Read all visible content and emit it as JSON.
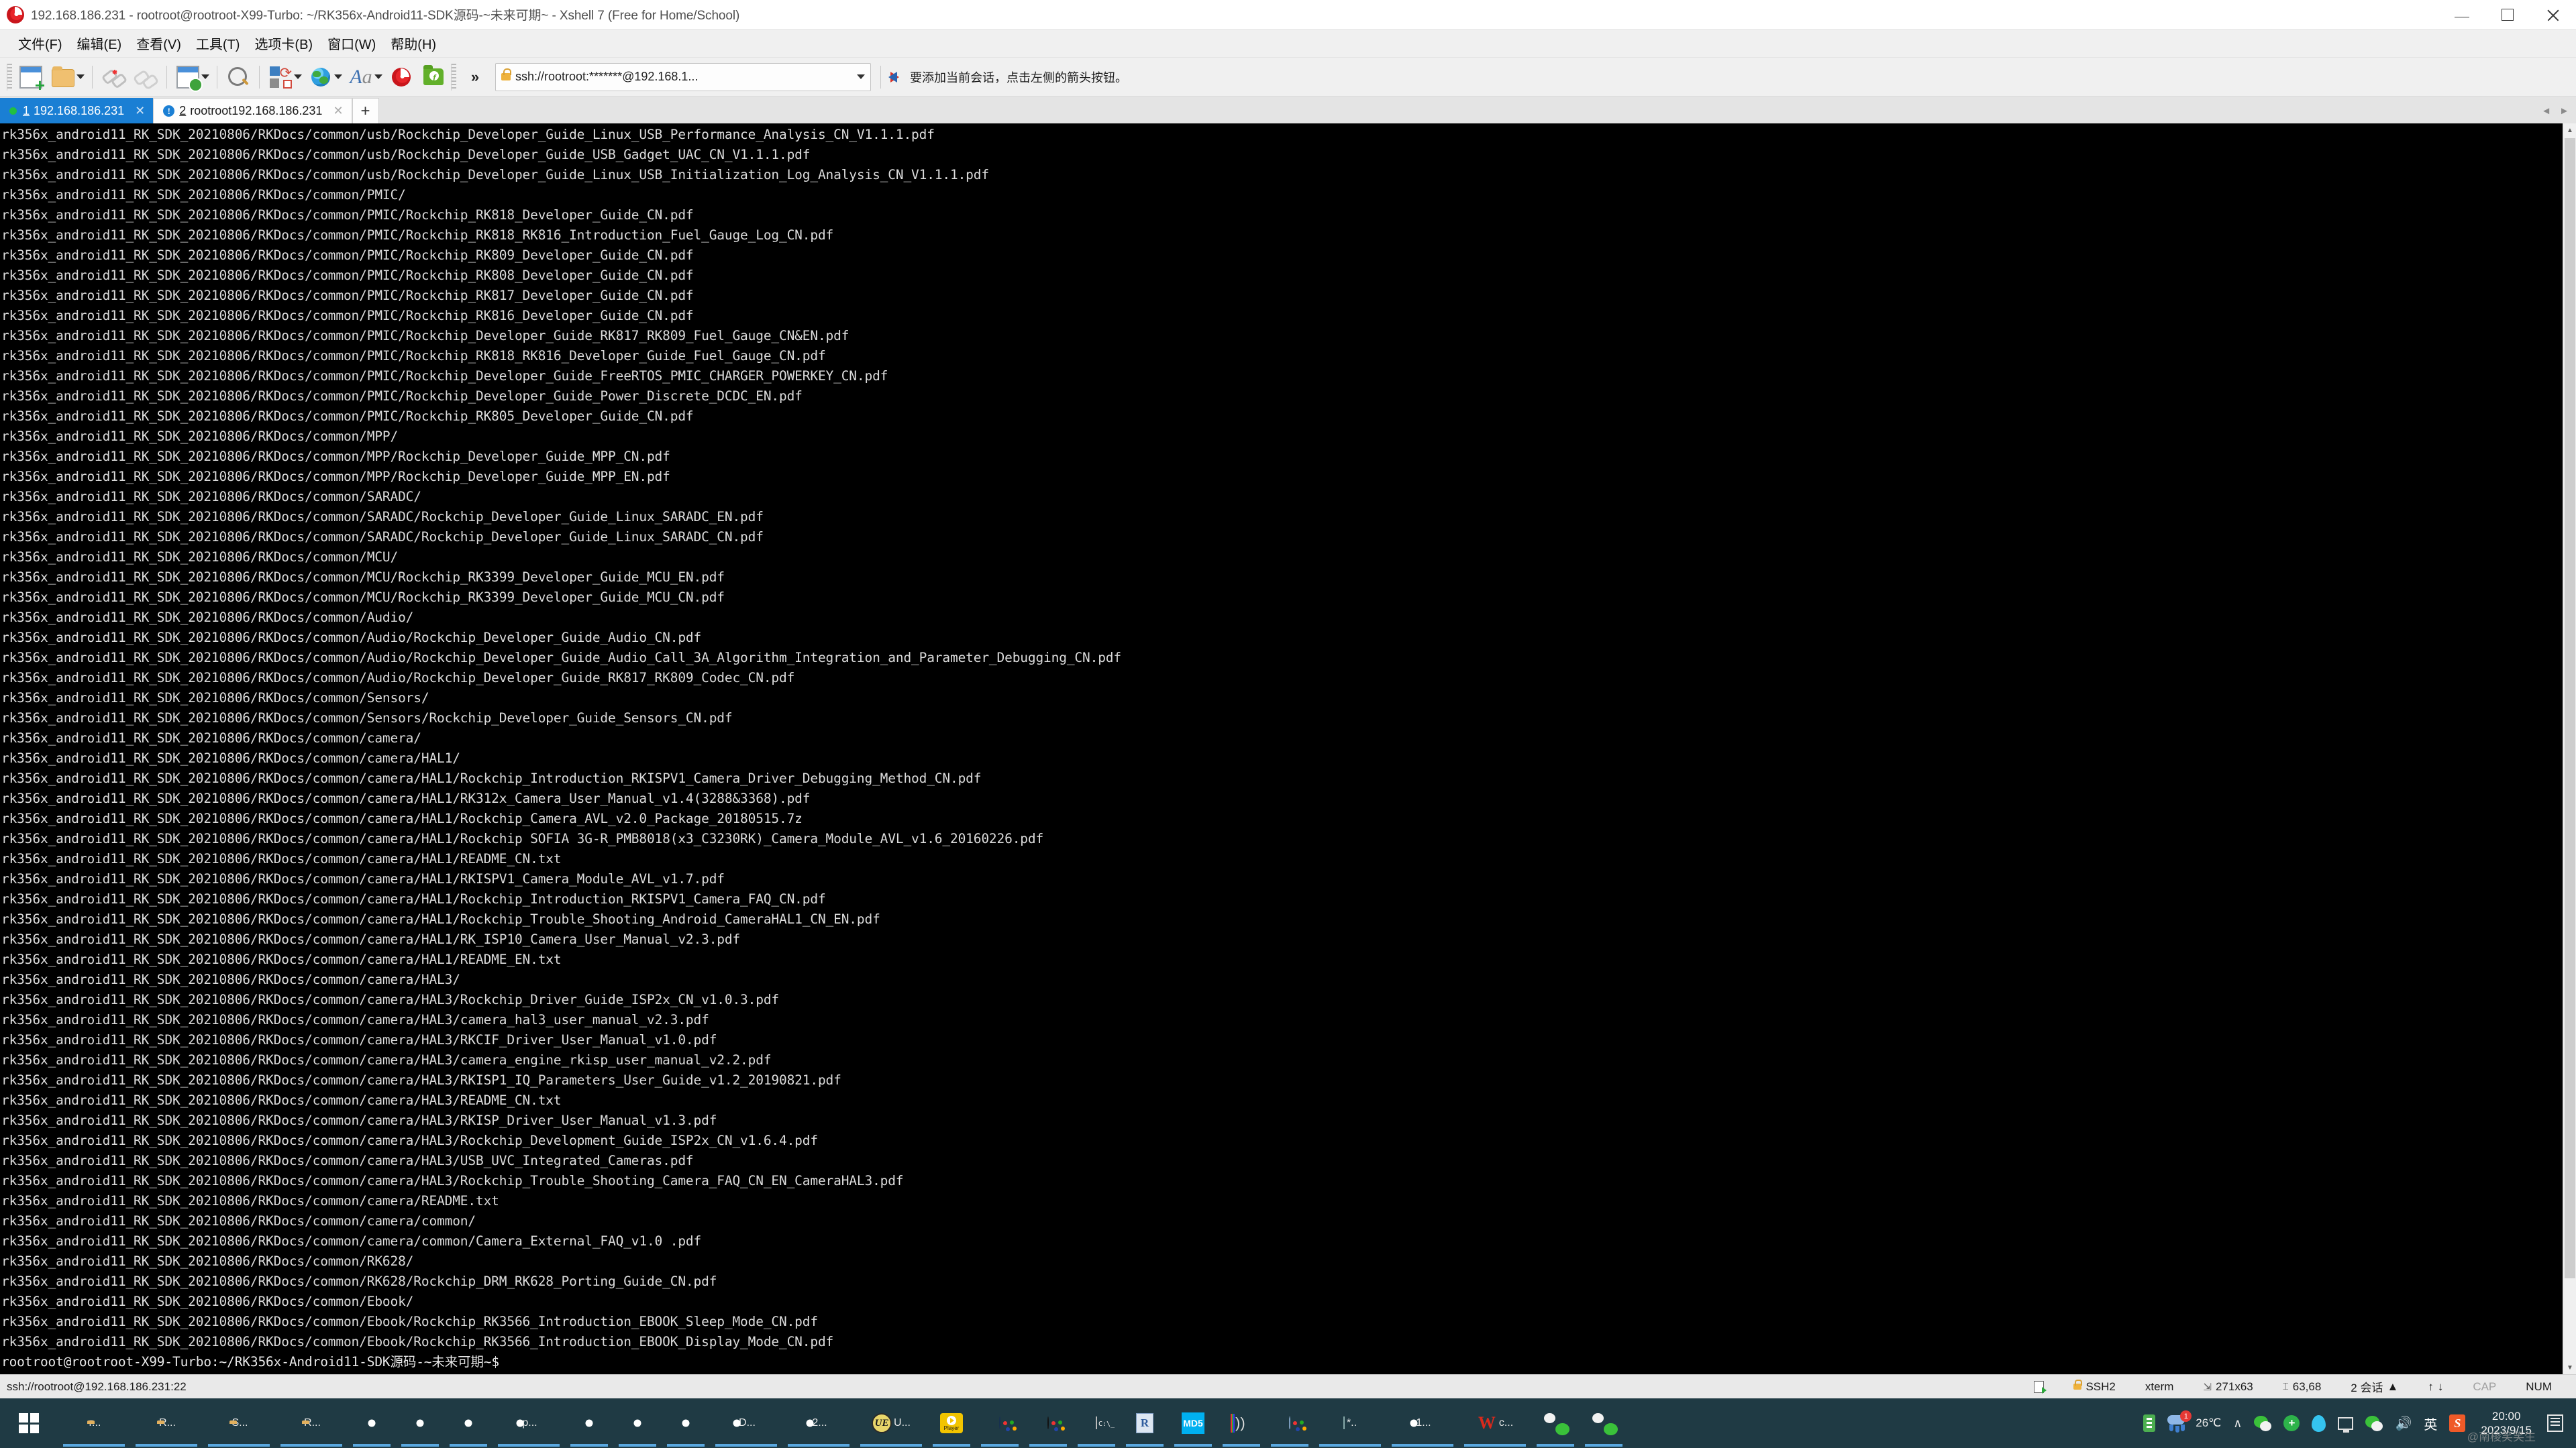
{
  "window": {
    "title": "192.168.186.231 - rootroot@rootroot-X99-Turbo: ~/RK356x-Android11-SDK源码-~未来可期~ - Xshell 7 (Free for Home/School)",
    "app_icon": "xshell-logo",
    "minimize": "–",
    "maximize": "□",
    "close": "✕"
  },
  "menubar": {
    "items": [
      {
        "label": "文件(F)"
      },
      {
        "label": "编辑(E)"
      },
      {
        "label": "查看(V)"
      },
      {
        "label": "工具(T)"
      },
      {
        "label": "选项卡(B)"
      },
      {
        "label": "窗口(W)"
      },
      {
        "label": "帮助(H)"
      }
    ]
  },
  "toolbar": {
    "buttons": [
      {
        "name": "new-session-icon",
        "tip": "新建会话"
      },
      {
        "name": "open-folder-icon",
        "tip": "打开"
      },
      {
        "name": "disconnect-icon",
        "tip": "断开"
      },
      {
        "name": "reconnect-icon",
        "tip": "重新连接"
      },
      {
        "name": "properties-icon",
        "tip": "属性"
      },
      {
        "name": "find-icon",
        "tip": "查找"
      },
      {
        "name": "transfer-icon",
        "tip": "传输"
      },
      {
        "name": "globe-icon",
        "tip": "编码"
      },
      {
        "name": "font-icon",
        "tip": "字体"
      },
      {
        "name": "xshell-icon",
        "tip": "Xshell"
      },
      {
        "name": "xftp-icon",
        "tip": "Xftp"
      },
      {
        "name": "overflow-icon",
        "tip": "更多"
      }
    ],
    "overflow_label": "»"
  },
  "addressbar": {
    "value": "ssh://rootroot:*******@192.168.1...",
    "dropdown": "▼",
    "hint": "要添加当前会话，点击左侧的箭头按钮。"
  },
  "tabs": {
    "items": [
      {
        "index": "1",
        "label": "192.168.186.231",
        "active": true,
        "status": "connected",
        "close": "✕"
      },
      {
        "index": "2",
        "label": "rootroot192.168.186.231",
        "active": false,
        "status": "alert",
        "alert_glyph": "!",
        "close": "✕"
      }
    ],
    "new_tab": "+",
    "scroll_left": "◄",
    "scroll_right": "►"
  },
  "terminal": {
    "cursor": "█",
    "lines": [
      "rk356x_android11_RK_SDK_20210806/RKDocs/common/usb/Rockchip_Developer_Guide_Linux_USB_Performance_Analysis_CN_V1.1.1.pdf",
      "rk356x_android11_RK_SDK_20210806/RKDocs/common/usb/Rockchip_Developer_Guide_USB_Gadget_UAC_CN_V1.1.1.pdf",
      "rk356x_android11_RK_SDK_20210806/RKDocs/common/usb/Rockchip_Developer_Guide_Linux_USB_Initialization_Log_Analysis_CN_V1.1.1.pdf",
      "rk356x_android11_RK_SDK_20210806/RKDocs/common/PMIC/",
      "rk356x_android11_RK_SDK_20210806/RKDocs/common/PMIC/Rockchip_RK818_Developer_Guide_CN.pdf",
      "rk356x_android11_RK_SDK_20210806/RKDocs/common/PMIC/Rockchip_RK818_RK816_Introduction_Fuel_Gauge_Log_CN.pdf",
      "rk356x_android11_RK_SDK_20210806/RKDocs/common/PMIC/Rockchip_RK809_Developer_Guide_CN.pdf",
      "rk356x_android11_RK_SDK_20210806/RKDocs/common/PMIC/Rockchip_RK808_Developer_Guide_CN.pdf",
      "rk356x_android11_RK_SDK_20210806/RKDocs/common/PMIC/Rockchip_RK817_Developer_Guide_CN.pdf",
      "rk356x_android11_RK_SDK_20210806/RKDocs/common/PMIC/Rockchip_RK816_Developer_Guide_CN.pdf",
      "rk356x_android11_RK_SDK_20210806/RKDocs/common/PMIC/Rockchip_Developer_Guide_RK817_RK809_Fuel_Gauge_CN&EN.pdf",
      "rk356x_android11_RK_SDK_20210806/RKDocs/common/PMIC/Rockchip_RK818_RK816_Developer_Guide_Fuel_Gauge_CN.pdf",
      "rk356x_android11_RK_SDK_20210806/RKDocs/common/PMIC/Rockchip_Developer_Guide_FreeRTOS_PMIC_CHARGER_POWERKEY_CN.pdf",
      "rk356x_android11_RK_SDK_20210806/RKDocs/common/PMIC/Rockchip_Developer_Guide_Power_Discrete_DCDC_EN.pdf",
      "rk356x_android11_RK_SDK_20210806/RKDocs/common/PMIC/Rockchip_RK805_Developer_Guide_CN.pdf",
      "rk356x_android11_RK_SDK_20210806/RKDocs/common/MPP/",
      "rk356x_android11_RK_SDK_20210806/RKDocs/common/MPP/Rockchip_Developer_Guide_MPP_CN.pdf",
      "rk356x_android11_RK_SDK_20210806/RKDocs/common/MPP/Rockchip_Developer_Guide_MPP_EN.pdf",
      "rk356x_android11_RK_SDK_20210806/RKDocs/common/SARADC/",
      "rk356x_android11_RK_SDK_20210806/RKDocs/common/SARADC/Rockchip_Developer_Guide_Linux_SARADC_EN.pdf",
      "rk356x_android11_RK_SDK_20210806/RKDocs/common/SARADC/Rockchip_Developer_Guide_Linux_SARADC_CN.pdf",
      "rk356x_android11_RK_SDK_20210806/RKDocs/common/MCU/",
      "rk356x_android11_RK_SDK_20210806/RKDocs/common/MCU/Rockchip_RK3399_Developer_Guide_MCU_EN.pdf",
      "rk356x_android11_RK_SDK_20210806/RKDocs/common/MCU/Rockchip_RK3399_Developer_Guide_MCU_CN.pdf",
      "rk356x_android11_RK_SDK_20210806/RKDocs/common/Audio/",
      "rk356x_android11_RK_SDK_20210806/RKDocs/common/Audio/Rockchip_Developer_Guide_Audio_CN.pdf",
      "rk356x_android11_RK_SDK_20210806/RKDocs/common/Audio/Rockchip_Developer_Guide_Audio_Call_3A_Algorithm_Integration_and_Parameter_Debugging_CN.pdf",
      "rk356x_android11_RK_SDK_20210806/RKDocs/common/Audio/Rockchip_Developer_Guide_RK817_RK809_Codec_CN.pdf",
      "rk356x_android11_RK_SDK_20210806/RKDocs/common/Sensors/",
      "rk356x_android11_RK_SDK_20210806/RKDocs/common/Sensors/Rockchip_Developer_Guide_Sensors_CN.pdf",
      "rk356x_android11_RK_SDK_20210806/RKDocs/common/camera/",
      "rk356x_android11_RK_SDK_20210806/RKDocs/common/camera/HAL1/",
      "rk356x_android11_RK_SDK_20210806/RKDocs/common/camera/HAL1/Rockchip_Introduction_RKISPV1_Camera_Driver_Debugging_Method_CN.pdf",
      "rk356x_android11_RK_SDK_20210806/RKDocs/common/camera/HAL1/RK312x_Camera_User_Manual_v1.4(3288&3368).pdf",
      "rk356x_android11_RK_SDK_20210806/RKDocs/common/camera/HAL1/Rockchip_Camera_AVL_v2.0_Package_20180515.7z",
      "rk356x_android11_RK_SDK_20210806/RKDocs/common/camera/HAL1/Rockchip SOFIA 3G-R_PMB8018(x3_C3230RK)_Camera_Module_AVL_v1.6_20160226.pdf",
      "rk356x_android11_RK_SDK_20210806/RKDocs/common/camera/HAL1/README_CN.txt",
      "rk356x_android11_RK_SDK_20210806/RKDocs/common/camera/HAL1/RKISPV1_Camera_Module_AVL_v1.7.pdf",
      "rk356x_android11_RK_SDK_20210806/RKDocs/common/camera/HAL1/Rockchip_Introduction_RKISPV1_Camera_FAQ_CN.pdf",
      "rk356x_android11_RK_SDK_20210806/RKDocs/common/camera/HAL1/Rockchip_Trouble_Shooting_Android_CameraHAL1_CN_EN.pdf",
      "rk356x_android11_RK_SDK_20210806/RKDocs/common/camera/HAL1/RK_ISP10_Camera_User_Manual_v2.3.pdf",
      "rk356x_android11_RK_SDK_20210806/RKDocs/common/camera/HAL1/README_EN.txt",
      "rk356x_android11_RK_SDK_20210806/RKDocs/common/camera/HAL3/",
      "rk356x_android11_RK_SDK_20210806/RKDocs/common/camera/HAL3/Rockchip_Driver_Guide_ISP2x_CN_v1.0.3.pdf",
      "rk356x_android11_RK_SDK_20210806/RKDocs/common/camera/HAL3/camera_hal3_user_manual_v2.3.pdf",
      "rk356x_android11_RK_SDK_20210806/RKDocs/common/camera/HAL3/RKCIF_Driver_User_Manual_v1.0.pdf",
      "rk356x_android11_RK_SDK_20210806/RKDocs/common/camera/HAL3/camera_engine_rkisp_user_manual_v2.2.pdf",
      "rk356x_android11_RK_SDK_20210806/RKDocs/common/camera/HAL3/RKISP1_IQ_Parameters_User_Guide_v1.2_20190821.pdf",
      "rk356x_android11_RK_SDK_20210806/RKDocs/common/camera/HAL3/README_CN.txt",
      "rk356x_android11_RK_SDK_20210806/RKDocs/common/camera/HAL3/RKISP_Driver_User_Manual_v1.3.pdf",
      "rk356x_android11_RK_SDK_20210806/RKDocs/common/camera/HAL3/Rockchip_Development_Guide_ISP2x_CN_v1.6.4.pdf",
      "rk356x_android11_RK_SDK_20210806/RKDocs/common/camera/HAL3/USB_UVC_Integrated_Cameras.pdf",
      "rk356x_android11_RK_SDK_20210806/RKDocs/common/camera/HAL3/Rockchip_Trouble_Shooting_Camera_FAQ_CN_EN_CameraHAL3.pdf",
      "rk356x_android11_RK_SDK_20210806/RKDocs/common/camera/README.txt",
      "rk356x_android11_RK_SDK_20210806/RKDocs/common/camera/common/",
      "rk356x_android11_RK_SDK_20210806/RKDocs/common/camera/common/Camera_External_FAQ_v1.0 .pdf",
      "rk356x_android11_RK_SDK_20210806/RKDocs/common/RK628/",
      "rk356x_android11_RK_SDK_20210806/RKDocs/common/RK628/Rockchip_DRM_RK628_Porting_Guide_CN.pdf",
      "rk356x_android11_RK_SDK_20210806/RKDocs/common/Ebook/",
      "rk356x_android11_RK_SDK_20210806/RKDocs/common/Ebook/Rockchip_RK3566_Introduction_EBOOK_Sleep_Mode_CN.pdf",
      "rk356x_android11_RK_SDK_20210806/RKDocs/common/Ebook/Rockchip_RK3566_Introduction_EBOOK_Display_Mode_CN.pdf"
    ],
    "prompt_line_1": "rootroot@rootroot-X99-Turbo:~/RK356x-Android11-SDK源码-~未来可期~$",
    "prompt_line_2": "rootroot@rootroot-X99-Turbo:~/RK356x-Android11-SDK源码-~未来可期~$"
  },
  "statusbar": {
    "connection": "ssh://rootroot@192.168.186.231:22",
    "log_icon": "log-icon",
    "protocol": "SSH2",
    "terminal_type": "xterm",
    "size": "271x63",
    "cursor_pos": "63,68",
    "sessions": "2 会话",
    "sessions_caret": "▲",
    "tx": "↑",
    "rx": "↓",
    "cap": "CAP",
    "num": "NUM"
  },
  "taskbar": {
    "start": "windows-logo",
    "items": [
      {
        "icon": "folder",
        "label": "r..."
      },
      {
        "icon": "folder",
        "label": "R..."
      },
      {
        "icon": "folder",
        "label": "S..."
      },
      {
        "icon": "folder",
        "label": "R..."
      },
      {
        "icon": "chrome",
        "label": ""
      },
      {
        "icon": "chrome",
        "label": ""
      },
      {
        "icon": "chrome",
        "label": ""
      },
      {
        "icon": "chrome",
        "label": "p..."
      },
      {
        "icon": "chrome",
        "label": ""
      },
      {
        "icon": "chrome",
        "label": ""
      },
      {
        "icon": "chrome",
        "label": ""
      },
      {
        "icon": "chrome",
        "label": "D..."
      },
      {
        "icon": "chrome",
        "label": "2..."
      },
      {
        "icon": "ultraedit",
        "label": "U..."
      },
      {
        "icon": "player",
        "label": ""
      },
      {
        "icon": "atom",
        "label": ""
      },
      {
        "icon": "burner",
        "label": ""
      },
      {
        "icon": "cmd",
        "label": ""
      },
      {
        "icon": "rstudio",
        "label": ""
      },
      {
        "icon": "md5",
        "label": ""
      },
      {
        "icon": "audio",
        "label": ""
      },
      {
        "icon": "paint",
        "label": ""
      },
      {
        "icon": "notepad",
        "label": "*.."
      },
      {
        "icon": "xshell",
        "label": "1..."
      },
      {
        "icon": "wps",
        "label": "c..."
      },
      {
        "icon": "wechat",
        "label": ""
      },
      {
        "icon": "wechat",
        "label": ""
      }
    ]
  },
  "tray": {
    "usb": "usb-icon",
    "weather_temp": "26℃",
    "weather_badge": "1",
    "expand": "∧",
    "icons": [
      "wechat-icon",
      "security-icon",
      "cloud-icon",
      "remote-icon",
      "wechat-icon",
      "volume-icon"
    ],
    "ime": "英",
    "sogou": "S",
    "time": "20:00",
    "date": "2023/9/15",
    "notification": "notification-icon",
    "watermark": "@南棱笑笑生"
  }
}
